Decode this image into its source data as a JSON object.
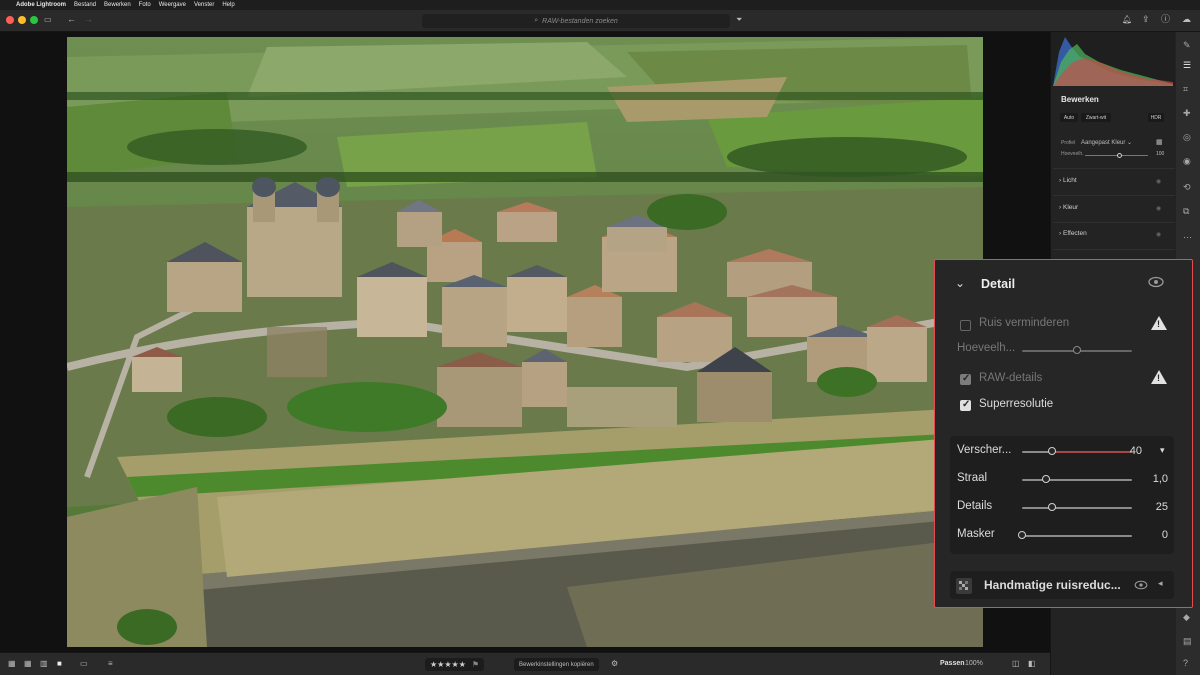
{
  "menubar": {
    "app_name": "Adobe Lightroom",
    "items": [
      "Bestand",
      "Bewerken",
      "Foto",
      "Weergave",
      "Venster",
      "Help"
    ]
  },
  "toolbar": {
    "search_placeholder": "RAW-bestanden zoeken"
  },
  "right_panel": {
    "title": "Bewerken",
    "buttons": [
      "Auto",
      "Zwart-wit",
      "HDR"
    ],
    "profile_label": "Profiel",
    "profile_value": "Aangepast Kleur",
    "amount_label": "Hoeveelh.",
    "amount_value": "100",
    "sections": [
      "Licht",
      "Kleur",
      "Effecten"
    ]
  },
  "detail_panel": {
    "title": "Detail",
    "noise": {
      "label": "Ruis verminderen",
      "checked": false,
      "amount_label": "Hoeveelh...",
      "amount_fraction": 0.5
    },
    "raw_details": {
      "label": "RAW-details",
      "checked": true
    },
    "super_resolution": {
      "label": "Superresolutie",
      "checked": true
    },
    "sharpening": [
      {
        "label": "Verscher...",
        "value": "40",
        "fraction": 0.27
      },
      {
        "label": "Straal",
        "value": "1,0",
        "fraction": 0.22
      },
      {
        "label": "Details",
        "value": "25",
        "fraction": 0.27
      },
      {
        "label": "Masker",
        "value": "0",
        "fraction": 0.0
      }
    ],
    "manual_noise": {
      "label": "Handmatige ruisreduc..."
    }
  },
  "bottombar": {
    "rating": "★★★★★",
    "copy_settings": "Bewerkinstellingen kopiëren",
    "fit": "Passen",
    "zoom": "100%"
  },
  "colors": {
    "accent_border": "#e34d52",
    "panel_bg": "#262626",
    "app_bg": "#1b1b1b"
  }
}
